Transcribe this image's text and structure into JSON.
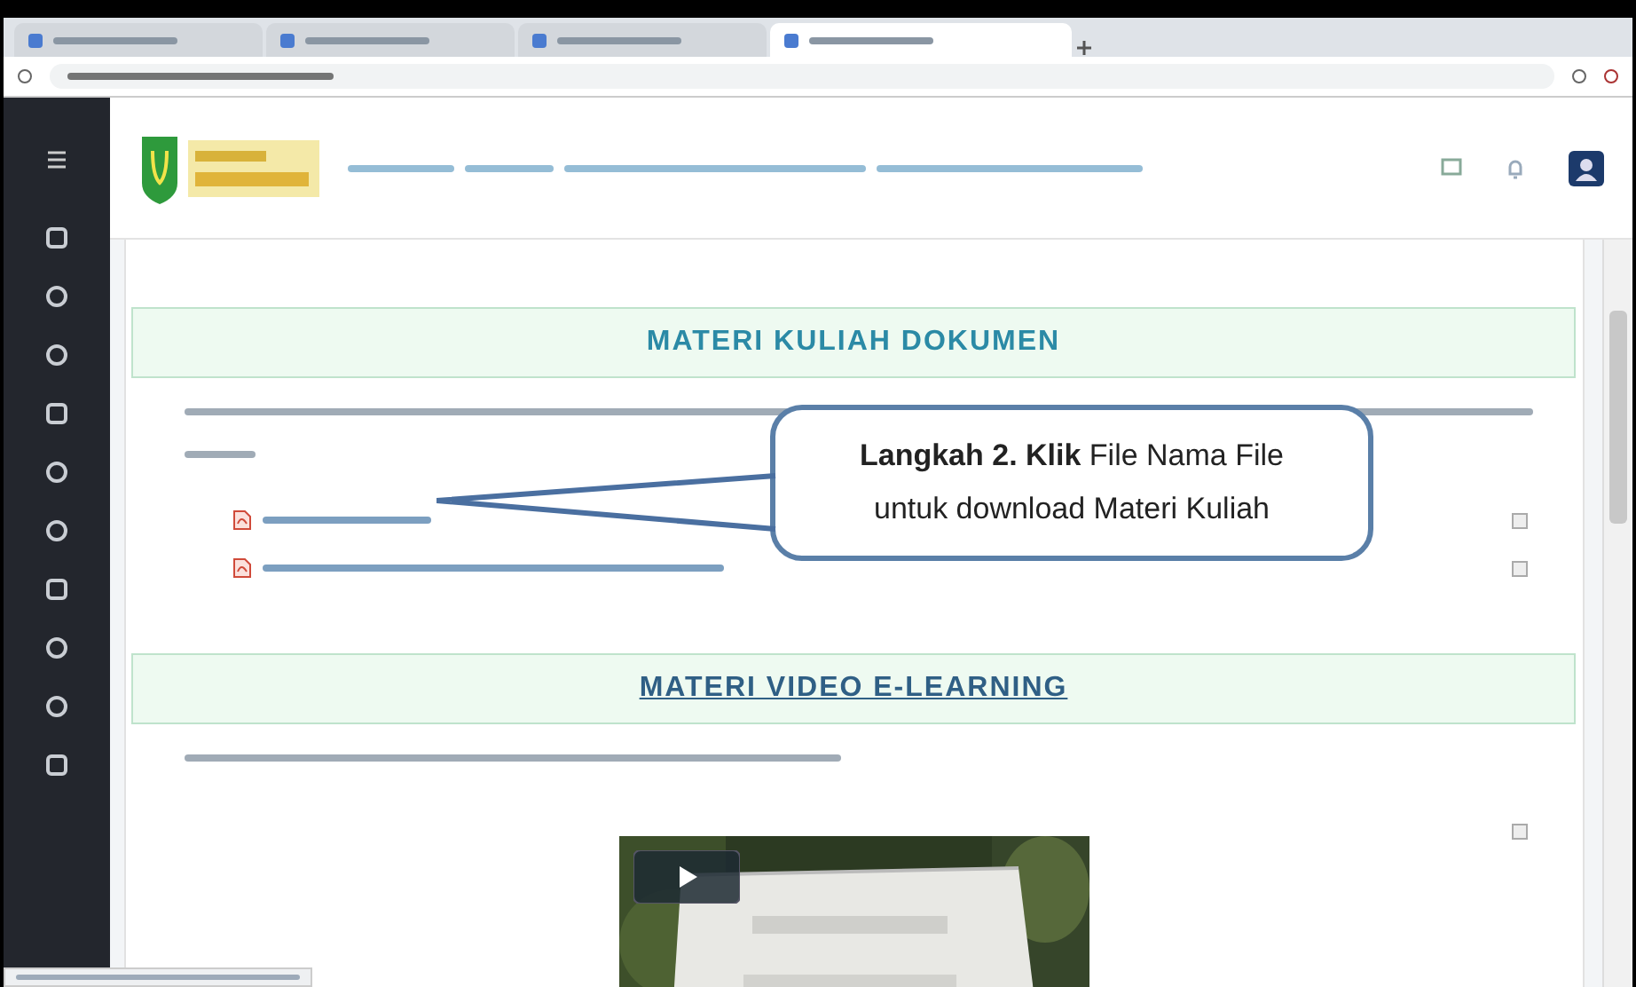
{
  "browser": {
    "tabs": [
      {
        "selected": false
      },
      {
        "selected": false
      },
      {
        "selected": false
      },
      {
        "selected": true
      }
    ]
  },
  "sections": [
    {
      "title": "MATERI KULIAH DOKUMEN",
      "kind": "plain",
      "files": [
        {
          "kind": "pdf"
        },
        {
          "kind": "pdf"
        }
      ]
    },
    {
      "title": "MATERI VIDEO E-LEARNING",
      "kind": "link"
    }
  ],
  "callout": {
    "text": "**Langkah 2. Klik** File Nama File untuk download Materi Kuliah"
  }
}
